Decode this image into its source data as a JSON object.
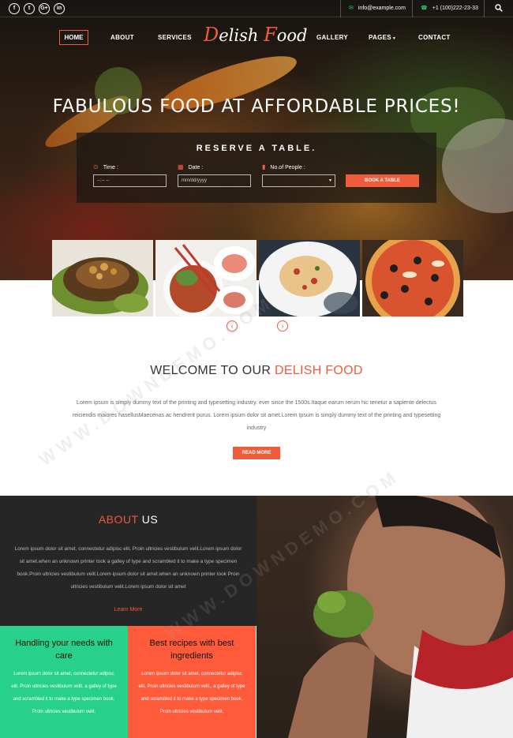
{
  "topbar": {
    "social": [
      "f",
      "t",
      "G+",
      "in"
    ],
    "email": "info@example.com",
    "phone": "+1 (100)222-23-33"
  },
  "nav": {
    "home": "HOME",
    "about": "ABOUT",
    "services": "SERVICES",
    "gallery": "GALLERY",
    "pages": "PAGES",
    "contact": "CONTACT"
  },
  "logo": {
    "cap1": "D",
    "rest1": "elish ",
    "cap2": "F",
    "rest2": "ood"
  },
  "hero": {
    "title": "FABULOUS FOOD AT AFFORDABLE PRICES!"
  },
  "reserve": {
    "title": "RESERVE A TABLE.",
    "time_label": "Time :",
    "date_label": "Date :",
    "people_label": "No.of People :",
    "time_value": "--:-- --",
    "date_value": "mm/dd/yyyy",
    "people_value": "",
    "button": "BOOK A TABLE"
  },
  "welcome": {
    "title_prefix": "WELCOME TO OUR ",
    "title_highlight": "DELISH FOOD",
    "text": "Lorem ipsum is simply dummy text of the printing and typesetting industry. ever since the 1500s.Itaque earum rerum hic tenetur a sapiente delectus reiciendis maiores hasellusMaecenas ac hendrerit purus. Lorem ipsum dolor sit amet.Lorem Ipsum is simply dummy text of the printing and typesetting industry",
    "button": "READ MORE"
  },
  "about": {
    "title_highlight": "ABOUT",
    "title_rest": " US",
    "text": "Lorem ipsum dolor sit amet, connectetur adipisc elit. Proin ultricies vestibulum velit.Lorem ipsum dolor sit amet.when an unknown printer took a galley of type and scrambled it to make a type specimen book.Proin ultricies vestibulum velit.Lorem ipsum dolor sit amet.when an unknown printer took Proin ultricies vestibulum velit.Lorem ipsum dolor sit amet",
    "link": "Learn More"
  },
  "cards": [
    {
      "title": "Handling your needs with care",
      "text": "Lorem ipsum dolor sit amet, connectetur adipisc elit. Proin ultricies vestibulum velit. a galley of type and scrambled it to make a type specimen book. Proin ultricies vestibulum velit.",
      "bg": "#27d08b"
    },
    {
      "title": "Best recipes with best ingredients",
      "text": "Lorem ipsum dolor sit amet, connectetur adipisc elit. Proin ultricies vestibulum velit., a galley of type and scrambled it to make a type specimen book. Proin ultricies vestibulum velit.",
      "bg": "#ff5a3a"
    }
  ],
  "colors": {
    "accent": "#ef5b3b",
    "green": "#27d08b",
    "dark": "#262626"
  },
  "icons": {
    "email": "envelope-icon",
    "phone": "phone-icon",
    "search": "search-icon",
    "time": "clock-icon",
    "date": "calendar-icon",
    "people": "users-icon",
    "prev": "chevron-left-icon",
    "next": "chevron-right-icon"
  },
  "watermark": "WWW.DOWNDEMO.COM"
}
